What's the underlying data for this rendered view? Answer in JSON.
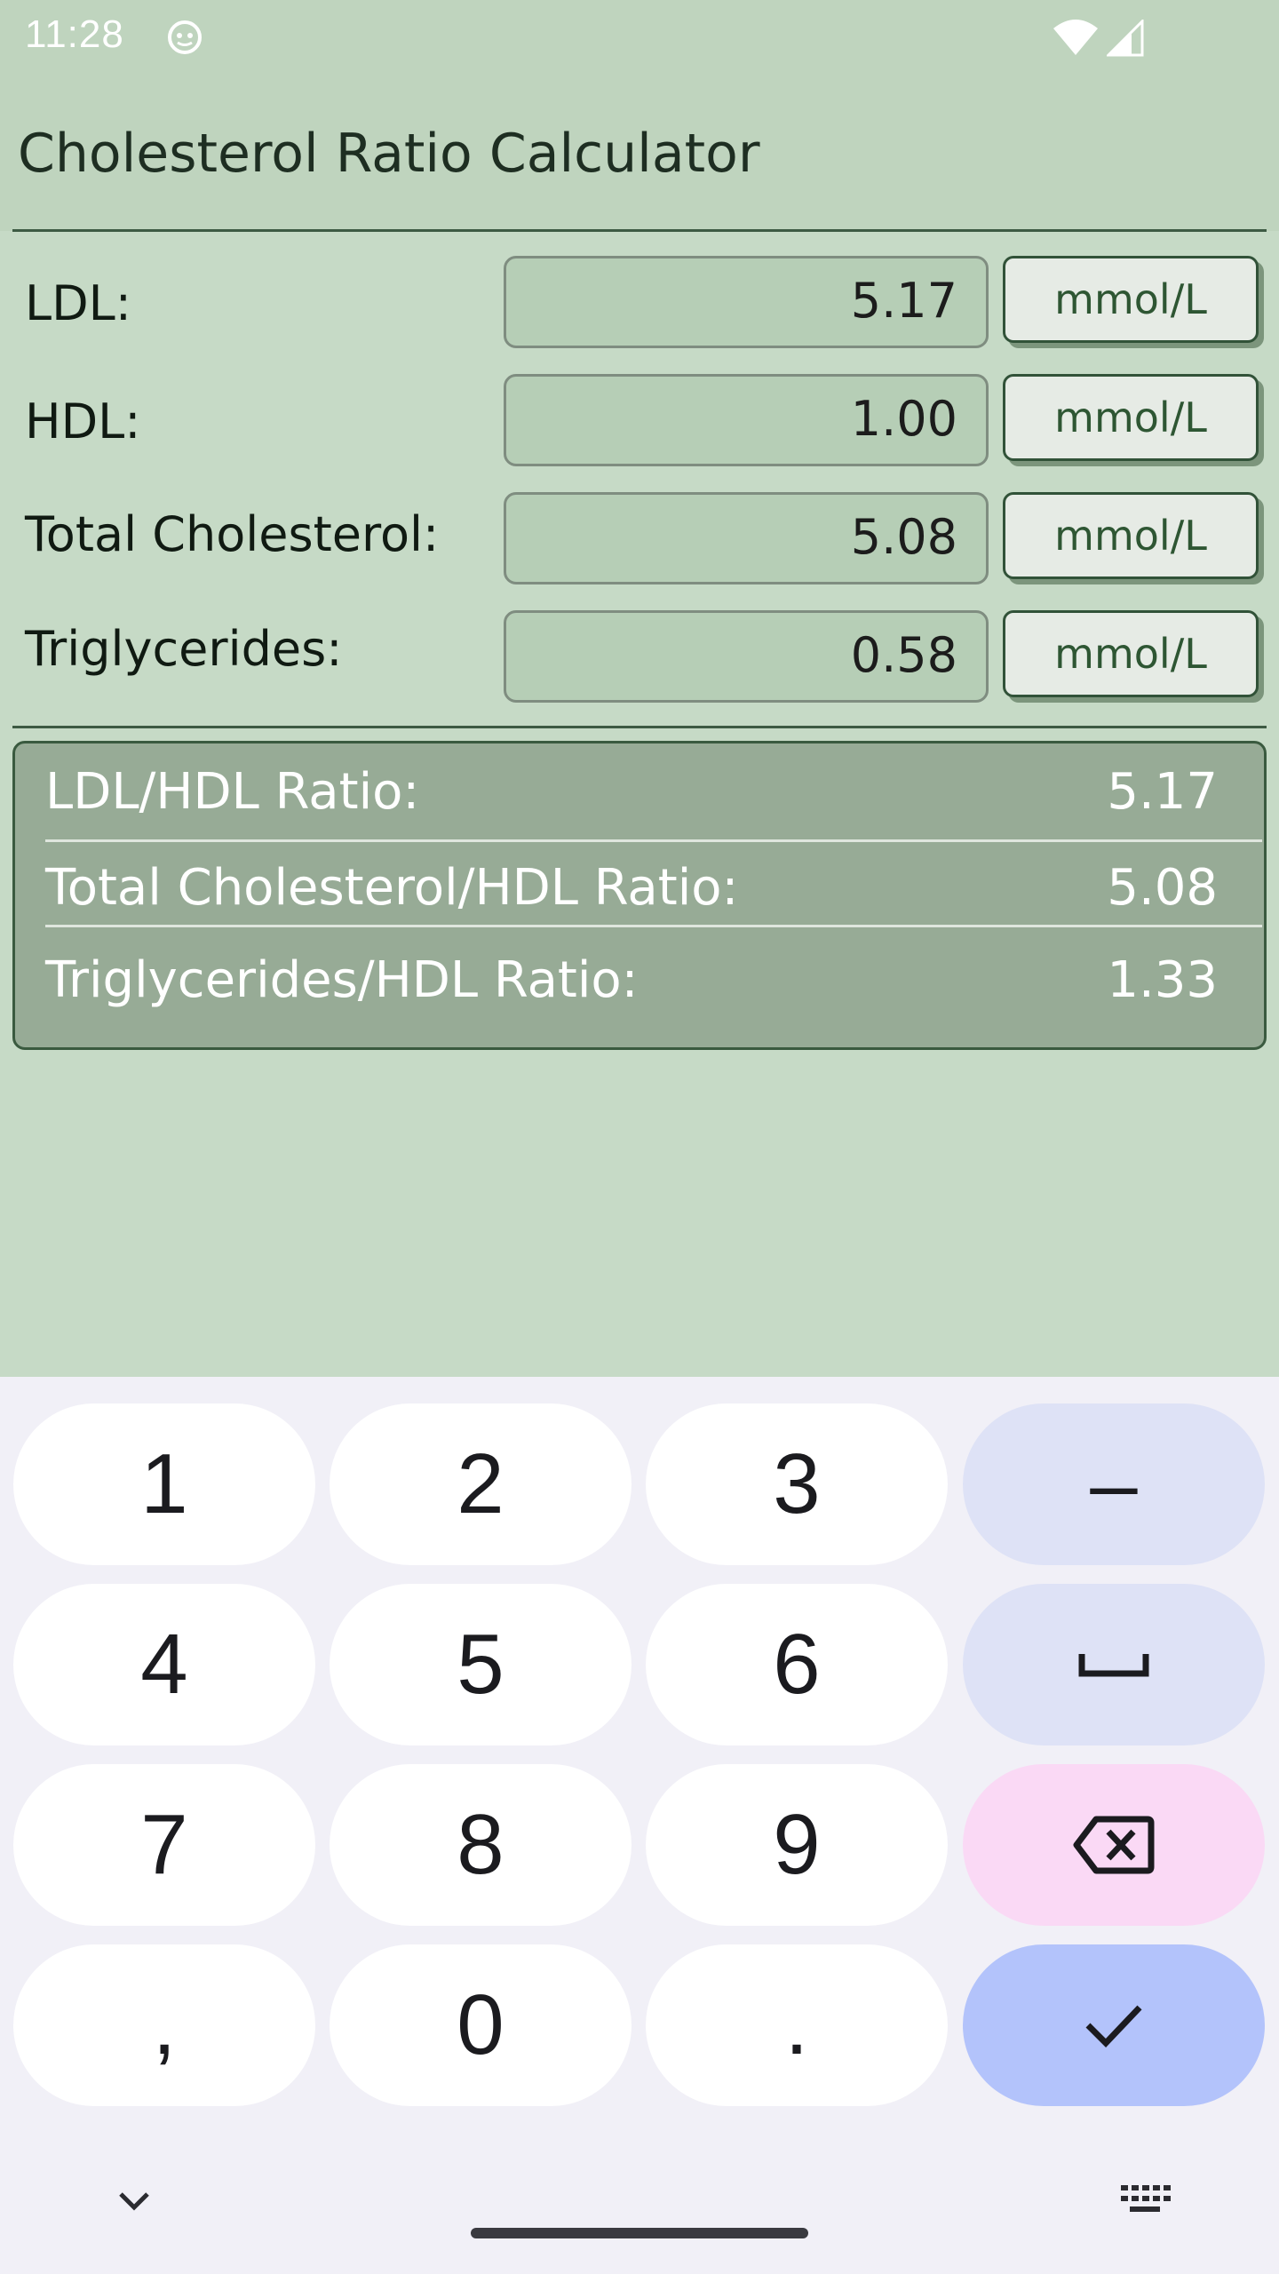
{
  "status_bar": {
    "time": "11:28",
    "icons": [
      "app-notification-icon",
      "wifi-icon",
      "cell-signal-icon"
    ]
  },
  "header": {
    "title": "Cholesterol Ratio Calculator"
  },
  "inputs": [
    {
      "label": "LDL:",
      "value": "5.17",
      "unit": "mmol/L"
    },
    {
      "label": "HDL:",
      "value": "1.00",
      "unit": "mmol/L"
    },
    {
      "label": "Total Cholesterol:",
      "value": "5.08",
      "unit": "mmol/L"
    },
    {
      "label": "Triglycerides:",
      "value": "0.58",
      "unit": "mmol/L"
    }
  ],
  "results": [
    {
      "label": "LDL/HDL Ratio:",
      "value": "5.17"
    },
    {
      "label": "Total Cholesterol/HDL Ratio:",
      "value": "5.08"
    },
    {
      "label": "Triglycerides/HDL Ratio:",
      "value": "1.33"
    }
  ],
  "keyboard": {
    "keys": [
      "1",
      "2",
      "3",
      "–",
      "4",
      "5",
      "6",
      "space-icon",
      "7",
      "8",
      "9",
      "backspace-icon",
      ",",
      "0",
      ".",
      "check-icon"
    ],
    "digits": {
      "k1": "1",
      "k2": "2",
      "k3": "3",
      "minus": "–",
      "k4": "4",
      "k5": "5",
      "k6": "6",
      "k7": "7",
      "k8": "8",
      "k9": "9",
      "comma": ",",
      "k0": "0",
      "period": "."
    }
  },
  "colors": {
    "background": "#c6dac6",
    "header": "#bfd4be",
    "accent_dark": "#3d5a43",
    "results_panel": "#97ab96",
    "unit_text": "#2e5633",
    "keyboard_bg": "#f1f0f7",
    "key_util": "#dee2f6",
    "key_delete": "#fad9f5",
    "key_confirm": "#b3c3fb"
  }
}
